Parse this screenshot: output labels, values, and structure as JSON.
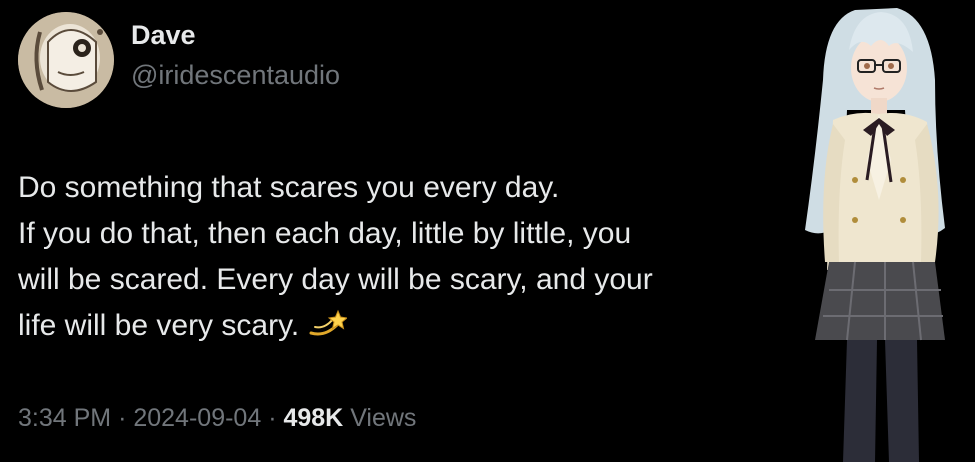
{
  "author": {
    "display_name": "Dave",
    "handle": "@iridescentaudio"
  },
  "tweet": {
    "lines": [
      "Do something that scares you every day.",
      "If you do that, then each day, little by little, you",
      "will be scared. Every day will be scary, and your",
      "life will be very scary."
    ],
    "emoji_icon": "dizzy-sparkle-icon"
  },
  "meta": {
    "time": "3:34 PM",
    "separator": "·",
    "date": "2024-09-04",
    "views_count": "498K",
    "views_label": "Views"
  },
  "colors": {
    "background": "#000000",
    "primary_text": "#e7e9ea",
    "secondary_text": "#71767b"
  }
}
